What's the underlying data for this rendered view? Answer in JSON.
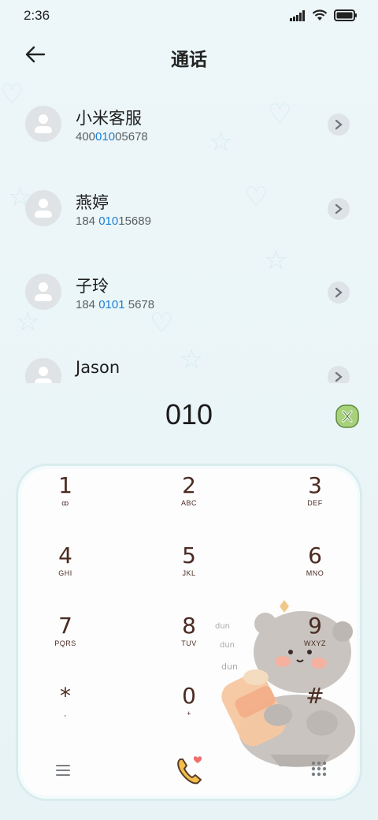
{
  "status": {
    "time": "2:36"
  },
  "header": {
    "title": "通话",
    "back_icon": "back-arrow-icon"
  },
  "contacts": [
    {
      "name": "小米客服",
      "num_pre": "400",
      "num_hl": "010",
      "num_post": "05678"
    },
    {
      "name": "燕婷",
      "num_pre": "184 ",
      "num_hl": "010",
      "num_post": "15689"
    },
    {
      "name": "子玲",
      "num_pre": "184 ",
      "num_hl": "0101",
      "num_post": " 5678"
    },
    {
      "name": "Jason",
      "num_pre": "",
      "num_hl": "",
      "num_post": ""
    }
  ],
  "dialer": {
    "number": "010"
  },
  "keypad": {
    "keys": [
      {
        "digit": "1",
        "letters": "ꝏ"
      },
      {
        "digit": "2",
        "letters": "ABC"
      },
      {
        "digit": "3",
        "letters": "DEF"
      },
      {
        "digit": "4",
        "letters": "GHI"
      },
      {
        "digit": "5",
        "letters": "JKL"
      },
      {
        "digit": "6",
        "letters": "MNO"
      },
      {
        "digit": "7",
        "letters": "PQRS"
      },
      {
        "digit": "8",
        "letters": "TUV"
      },
      {
        "digit": "9",
        "letters": "WXYZ"
      },
      {
        "digit": "*",
        "letters": ","
      },
      {
        "digit": "0",
        "letters": "+"
      },
      {
        "digit": "#",
        "letters": ""
      }
    ]
  },
  "colors": {
    "accent": "#1a7fd6",
    "key_text": "#4a2b22",
    "call_button": "#f2c04a"
  }
}
